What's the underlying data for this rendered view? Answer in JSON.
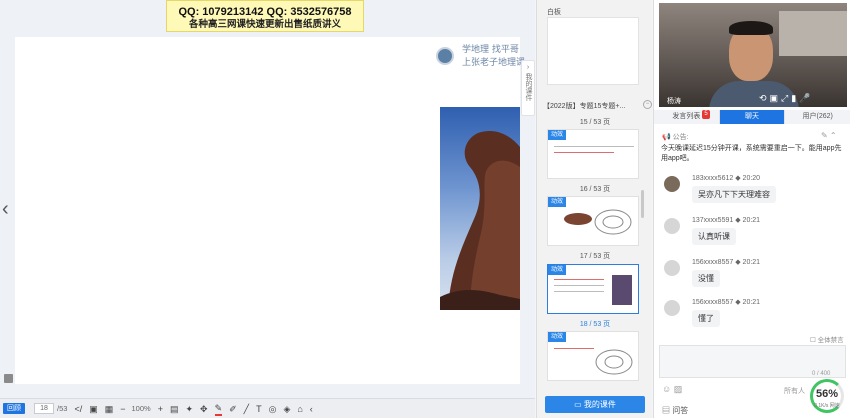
{
  "banner": {
    "line1": "QQ: 1079213142 QQ: 3532576758",
    "line2": "各种高三网课快速更新出售纸质讲义"
  },
  "slide": {
    "slogan_line1": "学地理 找平哥",
    "slogan_line2": "上张老子地理课"
  },
  "handle": {
    "label": "我的课件"
  },
  "toolbar": {
    "back_label": "回顾",
    "page_value": "18",
    "total": "/53",
    "zoom": "100%"
  },
  "sidebar": {
    "whiteboard_label": "白板",
    "course_title": "【2022版】专题15专题+...",
    "pages": [
      {
        "label": "15 / 53 页",
        "tag": "动效",
        "selected": false
      },
      {
        "label": "16 / 53 页",
        "tag": "动效",
        "selected": false
      },
      {
        "label": "17 / 53 页",
        "tag": "动效",
        "selected": true
      },
      {
        "label": "18 / 53 页",
        "tag": "动效",
        "selected": false
      }
    ],
    "my_course_button": "我的课件"
  },
  "video": {
    "name": "杨涛"
  },
  "tabs": {
    "speakers": "发言列表",
    "speakers_badge": "5",
    "chat": "聊天",
    "users": "用户(262)"
  },
  "notice": {
    "heading": "公告:",
    "text": "今天晚课延迟15分钟开课，系统需要重启一下。能用app先用app吧。"
  },
  "messages": [
    {
      "user": "183xxxx5612",
      "time": "20:20",
      "text": "吴亦凡下下天理难容"
    },
    {
      "user": "137xxxx5591",
      "time": "20:21",
      "text": "认真听课"
    },
    {
      "user": "156xxxx8557",
      "time": "20:21",
      "text": "没懂"
    },
    {
      "user": "156xxxx8557",
      "time": "20:21",
      "text": "懂了"
    }
  ],
  "chat_footer": {
    "mute_all": "全体禁言",
    "counter": "0 / 400",
    "recipient": "所有人",
    "qa_label": "问答"
  },
  "gauge": {
    "value": "56%",
    "sub": "0.1K/s 网速"
  }
}
